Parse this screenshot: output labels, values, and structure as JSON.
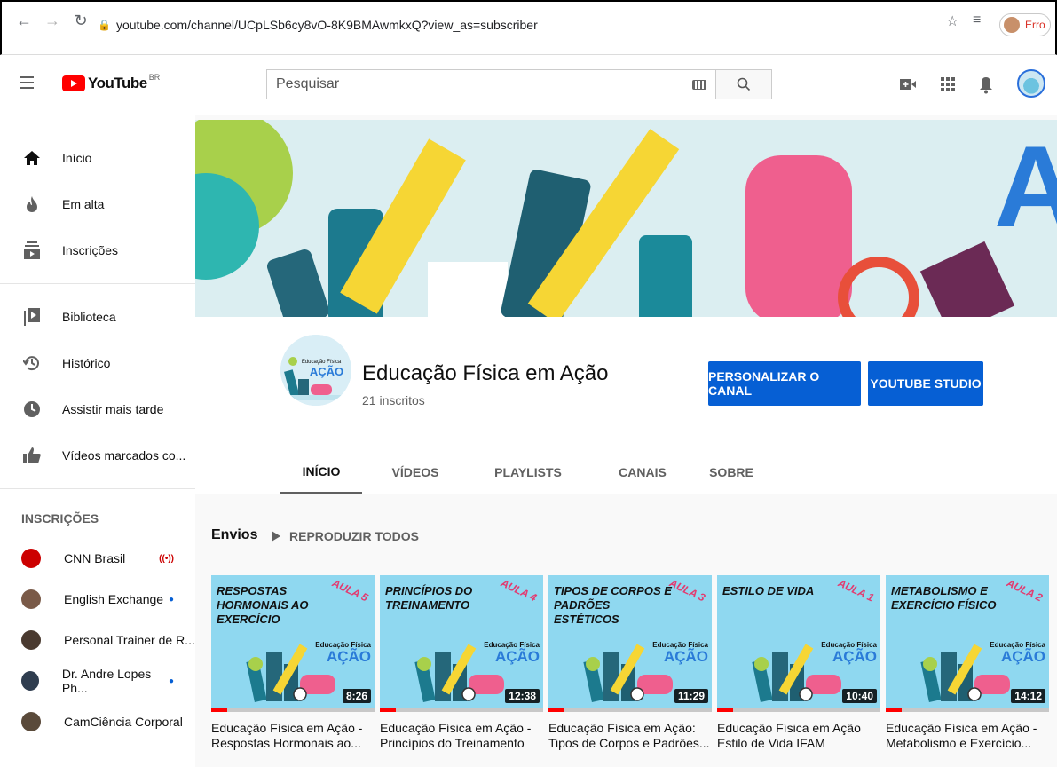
{
  "browser": {
    "url": "youtube.com/channel/UCpLSb6cy8vO-8K9BMAwmkxQ?view_as=subscriber",
    "profile_label": "Erro"
  },
  "masthead": {
    "logo_text": "YouTube",
    "country_code": "BR",
    "search_placeholder": "Pesquisar"
  },
  "sidebar": {
    "primary": [
      {
        "label": "Início",
        "icon": "home-icon"
      },
      {
        "label": "Em alta",
        "icon": "flame-icon"
      },
      {
        "label": "Inscrições",
        "icon": "subscriptions-icon"
      }
    ],
    "library": [
      {
        "label": "Biblioteca",
        "icon": "library-icon"
      },
      {
        "label": "Histórico",
        "icon": "history-icon"
      },
      {
        "label": "Assistir mais tarde",
        "icon": "clock-icon"
      },
      {
        "label": "Vídeos marcados co...",
        "icon": "thumbs-up-icon"
      }
    ],
    "subscriptions_heading": "INSCRIÇÕES",
    "subscriptions": [
      {
        "label": "CNN Brasil",
        "badge": "live",
        "color": "#cc0000"
      },
      {
        "label": "English Exchange",
        "badge": "dot",
        "color": "#7a5a48"
      },
      {
        "label": "Personal Trainer de R...",
        "badge": "",
        "color": "#4a3a30"
      },
      {
        "label": "Dr. Andre Lopes Ph...",
        "badge": "dot",
        "color": "#2f3d4f"
      },
      {
        "label": "CamCiência Corporal",
        "badge": "",
        "color": "#5a4a3a"
      }
    ]
  },
  "channel": {
    "name": "Educação Física em Ação",
    "subscribers": "21 inscritos",
    "avatar_text_top": "Educação Física",
    "avatar_text_main": "AÇÃO",
    "customize_button": "PERSONALIZAR O CANAL",
    "studio_button": "YOUTUBE STUDIO",
    "tabs": [
      "INÍCIO",
      "VÍDEOS",
      "PLAYLISTS",
      "CANAIS",
      "SOBRE"
    ],
    "active_tab": "INÍCIO"
  },
  "uploads": {
    "section_title": "Envios",
    "play_all": "REPRODUZIR TODOS",
    "videos": [
      {
        "thumb_title": "Respostas hormonais ao exercício",
        "aula": "AULA 5",
        "duration": "8:26",
        "title_line1": "Educação Física em Ação -",
        "title_line2": "Respostas Hormonais ao..."
      },
      {
        "thumb_title": "Princípios do treinamento",
        "aula": "AULA 4",
        "duration": "12:38",
        "title_line1": "Educação Física em Ação -",
        "title_line2": "Princípios do Treinamento"
      },
      {
        "thumb_title": "Tipos de corpos e padrões estéticos",
        "aula": "AULA 3",
        "duration": "11:29",
        "title_line1": "Educação Física em Ação:",
        "title_line2": "Tipos de Corpos e Padrões..."
      },
      {
        "thumb_title": "Estilo de vida",
        "aula": "AULA 1",
        "duration": "10:40",
        "title_line1": "Educação Física em Ação",
        "title_line2": "Estilo de Vida IFAM"
      },
      {
        "thumb_title": "Metabolismo e exercício físico",
        "aula": "AULA 2",
        "duration": "14:12",
        "title_line1": "Educação Física em Ação -",
        "title_line2": "Metabolismo e Exercício..."
      }
    ],
    "brand_top": "Educação Física",
    "brand_main": "AÇÃO"
  },
  "colors": {
    "accent_blue": "#065fd4",
    "youtube_red": "#ff0000",
    "thumb_background": "#8fd8f0",
    "aula_pink": "#e33a6f"
  }
}
